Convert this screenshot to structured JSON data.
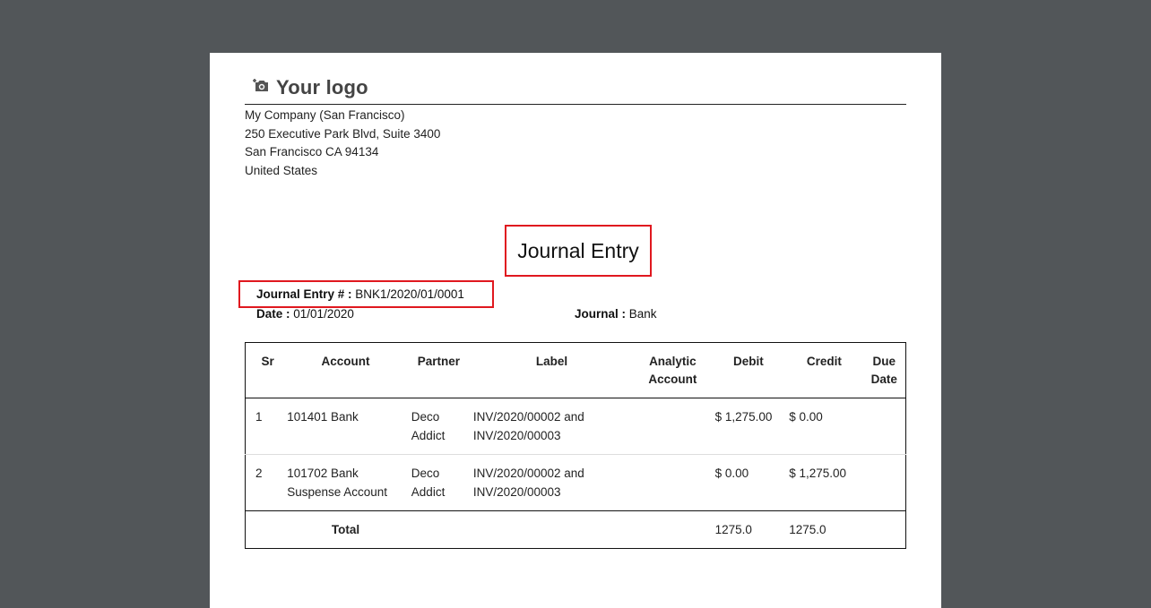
{
  "logo": {
    "icon": "camera-icon",
    "text": "Your logo"
  },
  "company": {
    "name": "My Company (San Francisco)",
    "street": "250 Executive Park Blvd, Suite 3400",
    "city": "San Francisco CA 94134",
    "country": "United States"
  },
  "title": "Journal Entry",
  "fields": {
    "entry_label": "Journal Entry # :",
    "entry_value": "BNK1/2020/01/0001",
    "date_label": "Date :",
    "date_value": "01/01/2020",
    "journal_label": "Journal :",
    "journal_value": "Bank"
  },
  "table": {
    "headers": {
      "sr": "Sr",
      "account": "Account",
      "partner": "Partner",
      "label": "Label",
      "analytic": "Analytic Account",
      "debit": "Debit",
      "credit": "Credit",
      "due": "Due Date"
    },
    "rows": [
      {
        "sr": "1",
        "account": "101401 Bank",
        "partner": "Deco Addict",
        "label": "INV/2020/00002 and INV/2020/00003",
        "analytic": "",
        "debit": "$ 1,275.00",
        "credit": "$ 0.00",
        "due": ""
      },
      {
        "sr": "2",
        "account": "101702 Bank Suspense Account",
        "partner": "Deco Addict",
        "label": "INV/2020/00002 and INV/2020/00003",
        "analytic": "",
        "debit": "$ 0.00",
        "credit": "$ 1,275.00",
        "due": ""
      }
    ],
    "total": {
      "label": "Total",
      "debit": "1275.0",
      "credit": "1275.0"
    }
  },
  "colors": {
    "backdrop": "#525659",
    "page": "#ffffff",
    "highlight": "#e0181f"
  }
}
